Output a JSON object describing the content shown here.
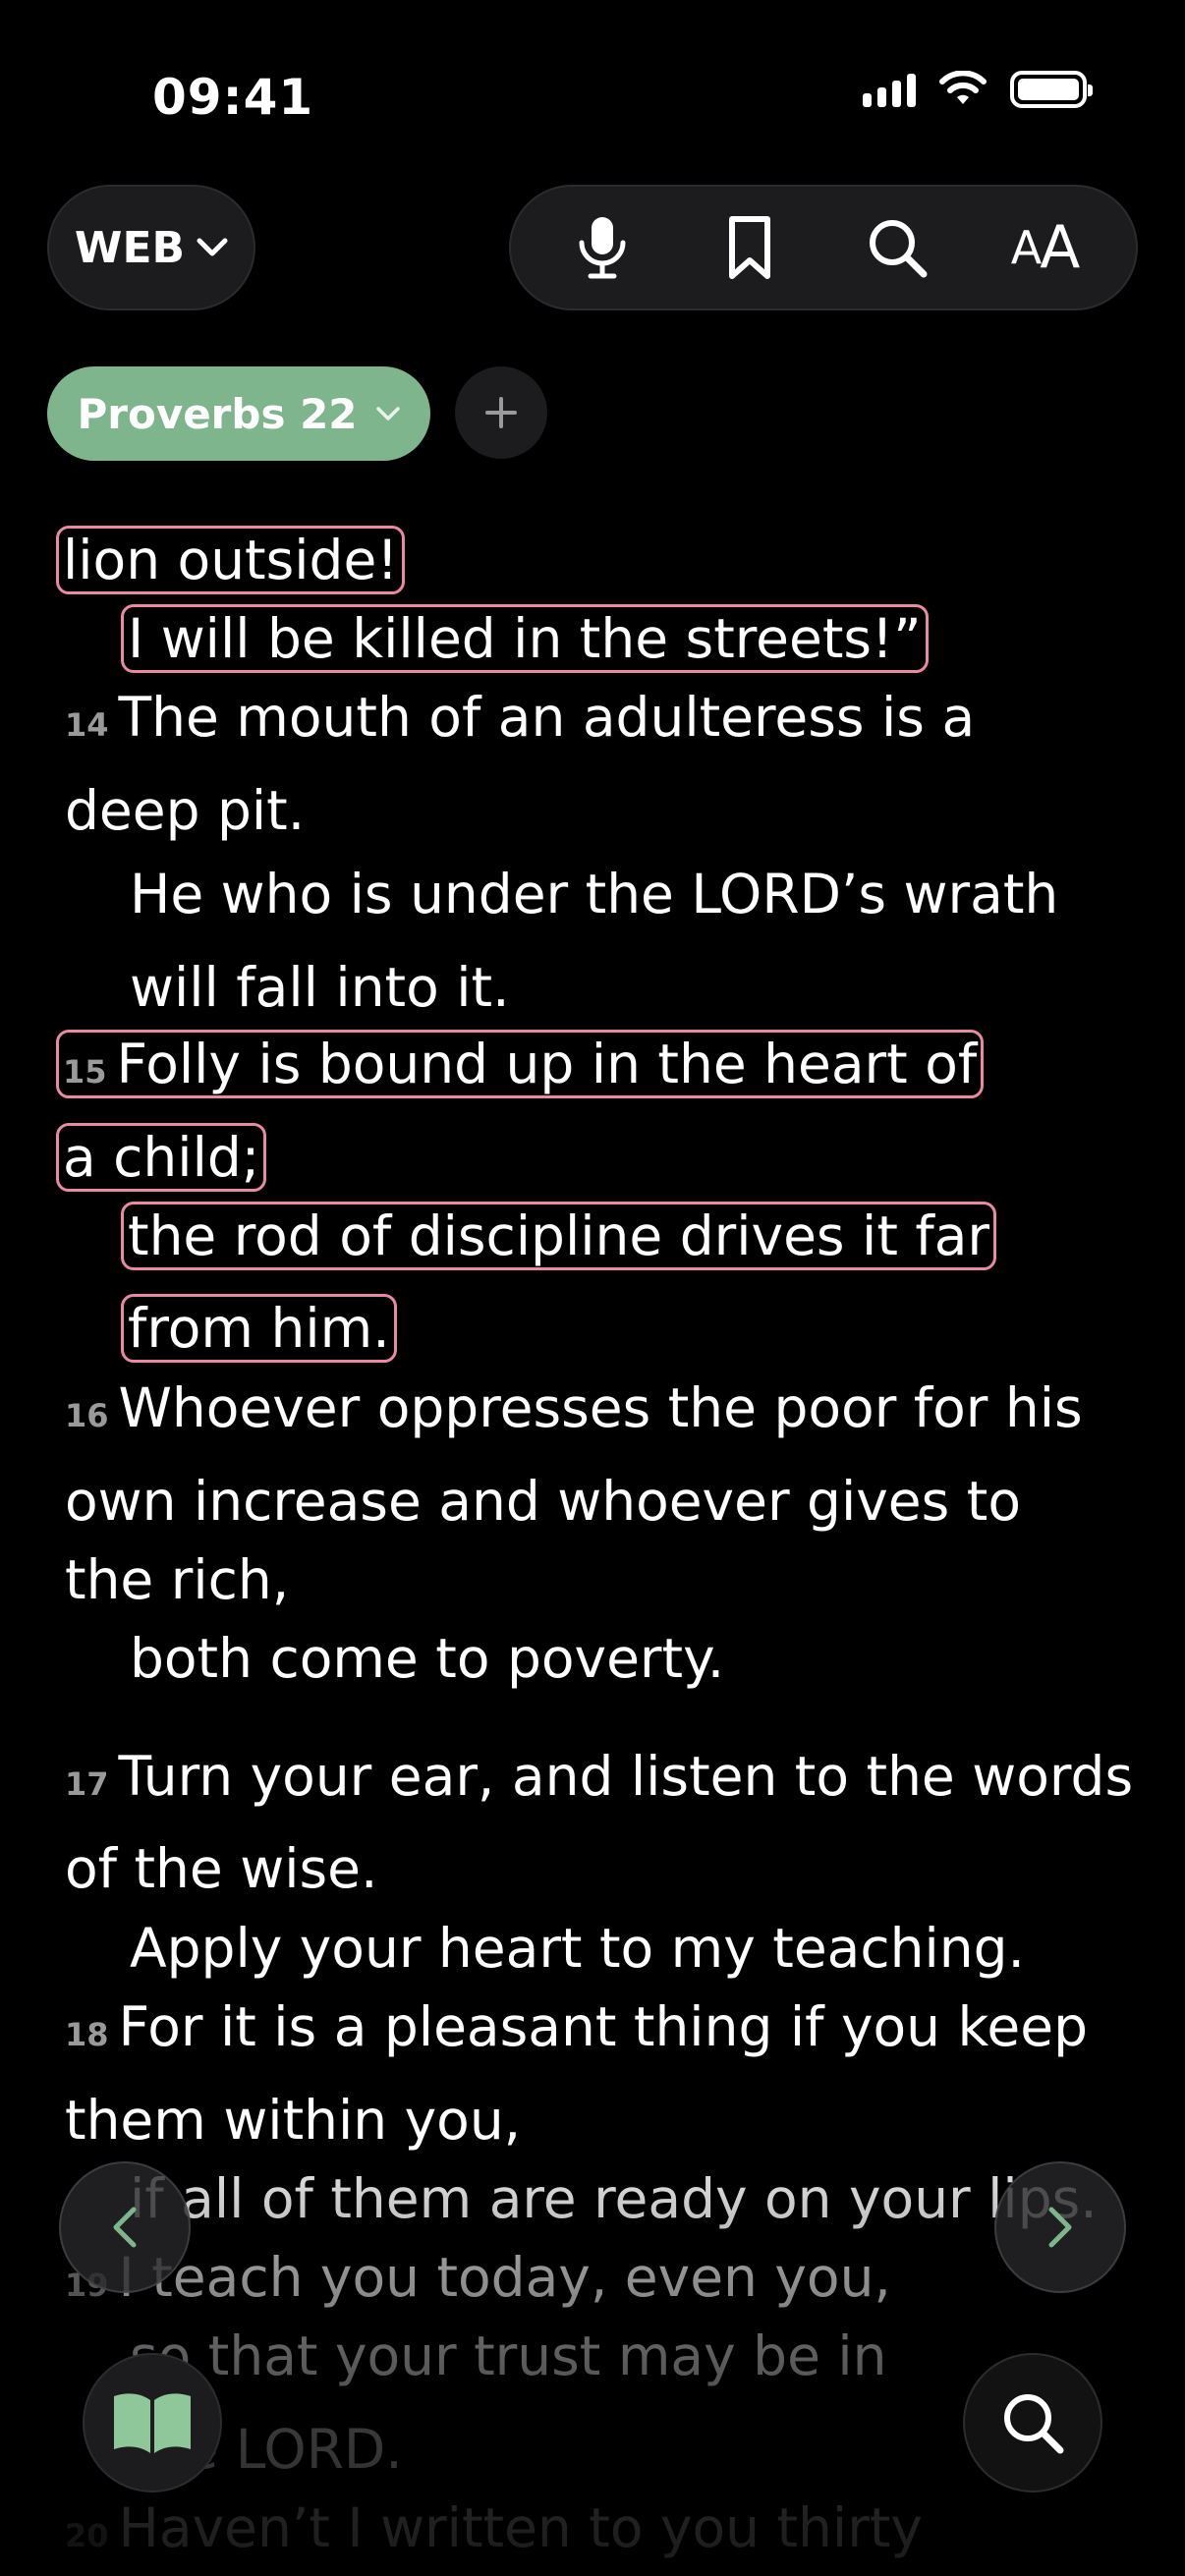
{
  "status_bar": {
    "time": "09:41"
  },
  "header": {
    "version_label": "WEB",
    "tools": [
      "microphone-icon",
      "bookmark-icon",
      "search-icon",
      "font-size-icon"
    ],
    "font_size_label_small": "A",
    "font_size_label_large": "A"
  },
  "chapter_tab": {
    "label": "Proverbs 22",
    "add_label": "+"
  },
  "colors": {
    "accent": "#7fb58c",
    "highlight_outline": "#e98aa3",
    "background": "#000000"
  },
  "lines": [
    {
      "verse": "",
      "text": "lion outside!",
      "indent": false,
      "highlight": true
    },
    {
      "verse": "",
      "text": "I will be killed in the streets!”",
      "indent": true,
      "highlight": true
    },
    {
      "verse": "14",
      "text": "The mouth of an adulteress is a",
      "indent": false,
      "highlight": false
    },
    {
      "verse": "",
      "text": "deep pit.",
      "indent": false,
      "highlight": false
    },
    {
      "verse": "",
      "text": "He who is under the LORD’s wrath",
      "indent": true,
      "highlight": false
    },
    {
      "verse": "",
      "text": "will fall into it.",
      "indent": true,
      "highlight": false
    },
    {
      "verse": "15",
      "text": "Folly is bound up in the heart of",
      "indent": false,
      "highlight": true
    },
    {
      "verse": "",
      "text": "a child;",
      "indent": false,
      "highlight": true
    },
    {
      "verse": "",
      "text": "the rod of discipline drives it far",
      "indent": true,
      "highlight": true
    },
    {
      "verse": "",
      "text": "from him.",
      "indent": true,
      "highlight": true
    },
    {
      "verse": "16",
      "text": "Whoever oppresses the poor for his",
      "indent": false,
      "highlight": false
    },
    {
      "verse": "",
      "text": "own increase and whoever gives to",
      "indent": false,
      "highlight": false
    },
    {
      "verse": "",
      "text": "the rich,",
      "indent": false,
      "highlight": false
    },
    {
      "verse": "",
      "text": "both come to poverty.",
      "indent": true,
      "highlight": false
    },
    {
      "verse": "17",
      "text": "Turn your ear, and listen to the words",
      "indent": false,
      "highlight": false
    },
    {
      "verse": "",
      "text": "of the wise.",
      "indent": false,
      "highlight": false
    },
    {
      "verse": "",
      "text": "Apply your heart to my teaching.",
      "indent": true,
      "highlight": false
    },
    {
      "verse": "18",
      "text": "For it is a pleasant thing if you keep",
      "indent": false,
      "highlight": false
    },
    {
      "verse": "",
      "text": "them within you,",
      "indent": false,
      "highlight": false
    },
    {
      "verse": "",
      "text": "if all of them are ready on your lips.",
      "indent": true,
      "highlight": false
    },
    {
      "verse": "19",
      "text": "I teach you today, even you,",
      "indent": false,
      "highlight": false
    },
    {
      "verse": "",
      "text": "so that your trust may be in",
      "indent": true,
      "highlight": false
    },
    {
      "verse": "",
      "text": "the LORD.",
      "indent": true,
      "highlight": false
    },
    {
      "verse": "20",
      "text": "Haven’t I written to you thirty",
      "indent": false,
      "highlight": false
    }
  ]
}
